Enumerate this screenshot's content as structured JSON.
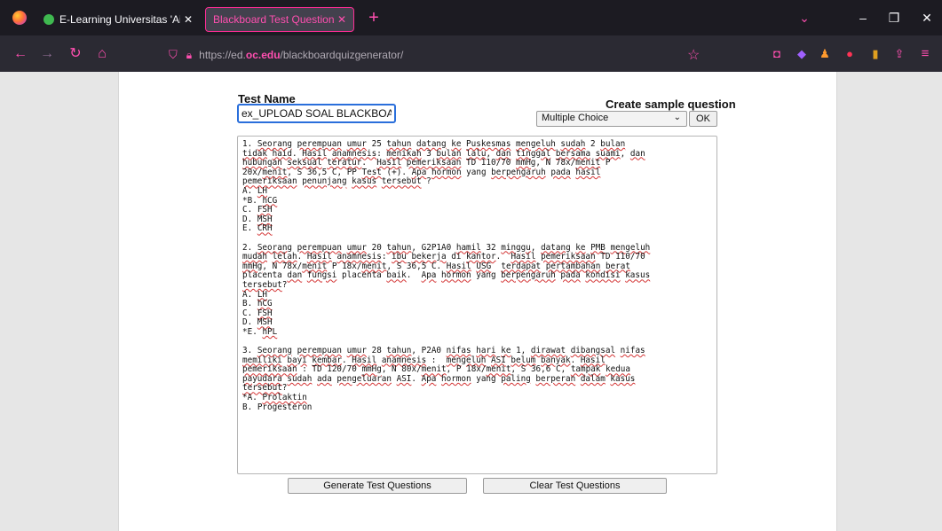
{
  "browser": {
    "tabs": [
      {
        "title": "E-Learning Universitas 'Aisyiyah",
        "close": "✕",
        "active": false
      },
      {
        "title": "Blackboard Test Question Generator",
        "close": "✕",
        "active": true
      }
    ],
    "new_tab": "+",
    "url_prefix": "https://ed.",
    "url_domain": "oc.edu",
    "url_path": "/blackboardquizgenerator/",
    "colors": {
      "accent": "#ff4fb0",
      "chrome_bg": "#1c1b22",
      "toolbar_bg": "#2b2a33"
    }
  },
  "form": {
    "test_name_label": "Test Name",
    "test_name_value": "ex_UPLOAD SOAL BLACKBOARD",
    "sample_label": "Create sample question",
    "sample_selected": "Multiple Choice",
    "ok_label": "OK",
    "generate_label": "Generate Test Questions",
    "clear_label": "Clear Test Questions"
  },
  "questions_lines": [
    "1. Seorang perempuan umur 25 tahun datang ke Puskesmas mengeluh sudah 2 bulan",
    "tidak haid. Hasil anamnesis: menikah 3 bulan lalu, dan tinggal bersama suami, dan",
    "hubungan seksual teratur.  Hasil pemeriksaan TD 110/70 mmHg, N 78x/menit P",
    "20x/menit, S 36,5 C, PP Test (+). Apa hormon yang berpengaruh pada hasil",
    "pemeriksaan penunjang kasus tersebut ?",
    "A. LH",
    "*B. hCG",
    "C. FSH",
    "D. MSH",
    "E. CRH",
    "",
    "2. Seorang perempuan umur 20 tahun, G2P1A0 hamil 32 minggu, datang ke PMB mengeluh",
    "mudah lelah. Hasil anamnesis: ibu bekerja di kantor.  Hasil pemeriksaan TD 110/70",
    "mmHg, N 78x/menit P 18x/menit, S 36,5 C. Hasil USG  terdapat pertambahan berat",
    "placenta dan fungsi placenta baik.  Apa hormon yang berpengaruh pada kondisi kasus",
    "tersebut?",
    "A. LH",
    "B. hCG",
    "C. FSH",
    "D. MSH",
    "*E. hPL",
    "",
    "3. Seorang perempuan umur 28 tahun, P2A0 nifas hari ke 1, dirawat dibangsal nifas",
    "memiliki bayi kembar. Hasil anamnesis :  mengeluh ASI belum banyak. Hasil",
    "pemeriksaan : TD 120/70 mmHg, N 80x/menit, P 18x/menit, S 36,6 C, tampak kedua",
    "payudara sudah ada pengeluaran ASI. Apa hormon yang paling berperan dalam kasus",
    "tersebut?",
    "*A. Prolaktin",
    "B. Progesteron"
  ],
  "spellcheck_words": [
    "Seorang",
    "perempuan",
    "umur",
    "tahun",
    "datang",
    "Puskesmas",
    "mengeluh",
    "sudah",
    "bulan",
    "tidak",
    "haid",
    "Hasil",
    "anamnesis",
    "menikah",
    "lalu",
    "dan",
    "tinggal",
    "bersama",
    "suami",
    "hubungan",
    "seksual",
    "teratur",
    "pemeriksaan",
    "mmHg",
    "menit",
    "Apa",
    "hormon",
    "berpengaruh",
    "pada",
    "hasil",
    "penunjang",
    "kasus",
    "tersebut",
    "LH",
    "hCG",
    "FSH",
    "MSH",
    "CRH",
    "hamil",
    "minggu",
    "PMB",
    "mudah",
    "lelah",
    "ibu",
    "bekerja",
    "kantor",
    "USG",
    "terdapat",
    "pertambahan",
    "berat",
    "fungsi",
    "baik",
    "kondisi",
    "hPL",
    "nifas",
    "hari",
    "dirawat",
    "dibangsal",
    "memiliki",
    "bayi",
    "kembar",
    "ASI",
    "belum",
    "banyak",
    "tampak",
    "kedua",
    "payudara",
    "ada",
    "pengeluaran",
    "berperan",
    "dalam",
    "Prolaktin",
    "ke",
    "Test",
    "paling"
  ]
}
